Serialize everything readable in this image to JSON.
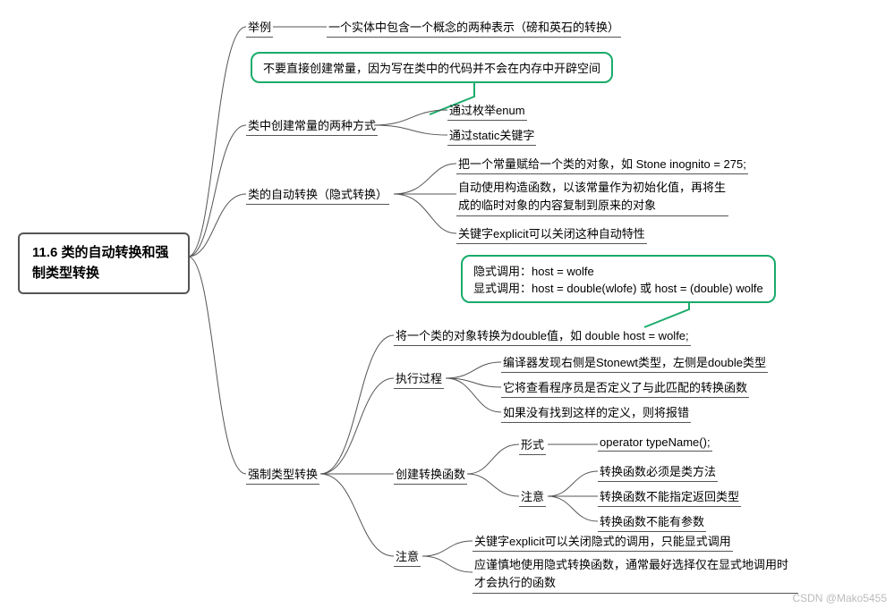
{
  "root": "11.6 类的自动转换和强制类型转换",
  "l1": {
    "example": "举例",
    "constTwo": "类中创建常量的两种方式",
    "autoConv": "类的自动转换（隐式转换）",
    "forceConv": "强制类型转换"
  },
  "example_leaf": "一个实体中包含一个概念的两种表示（磅和英石的转换）",
  "callout1": "不要直接创建常量，因为写在类中的代码并不会在内存中开辟空间",
  "const_children": {
    "c1": "通过枚举enum",
    "c2": "通过static关键字"
  },
  "auto_children": {
    "a1": "把一个常量赋给一个类的对象，如 Stone inognito = 275;",
    "a2": "自动使用构造函数，以该常量作为初始化值，再将生成的临时对象的内容复制到原来的对象",
    "a3": "关键字explicit可以关闭这种自动特性"
  },
  "callout2_l1": "隐式调用：host = wolfe",
  "callout2_l2": "显式调用：host = double(wlofe) 或 host = (double) wolfe",
  "force_children": {
    "f1": "将一个类的对象转换为double值，如 double host = wolfe;",
    "exec": "执行过程",
    "createFn": "创建转换函数",
    "notice": "注意"
  },
  "exec_children": {
    "e1": "编译器发现右侧是Stonewt类型，左侧是double类型",
    "e2": "它将查看程序员是否定义了与此匹配的转换函数",
    "e3": "如果没有找到这样的定义，则将报错"
  },
  "createFn_children": {
    "form": "形式",
    "form_leaf": "operator typeName();",
    "notice": "注意",
    "n1": "转换函数必须是类方法",
    "n2": "转换函数不能指定返回类型",
    "n3": "转换函数不能有参数"
  },
  "force_notice": {
    "fn1": "关键字explicit可以关闭隐式的调用，只能显式调用",
    "fn2": "应谨慎地使用隐式转换函数，通常最好选择仅在显式地调用时才会执行的函数"
  },
  "watermark": "CSDN @Mako5455"
}
